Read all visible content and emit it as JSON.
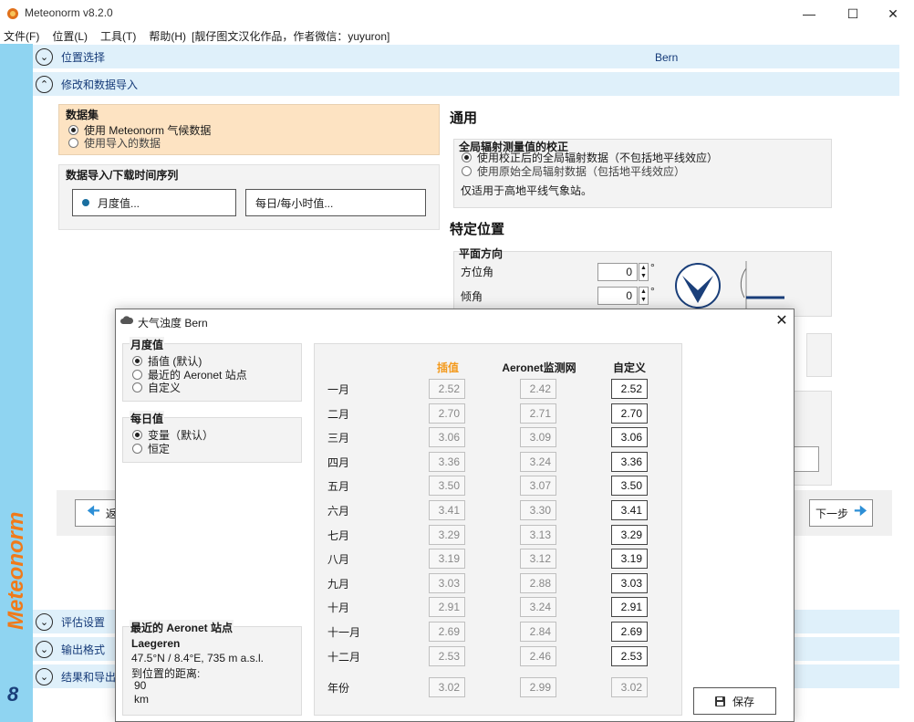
{
  "app": {
    "title": "Meteonorm v8.2.0"
  },
  "window_controls": {
    "minimize": "—",
    "maximize": "☐",
    "close": "✕"
  },
  "menu": [
    "文件(F)",
    "位置(L)",
    "工具(T)",
    "帮助(H)",
    "[靓仔图文汉化作品，作者微信：yuyuron]"
  ],
  "sidebar": {
    "brand": "Meteonorm",
    "version": "8"
  },
  "sections": {
    "location": {
      "label": "位置选择",
      "value": "Bern"
    },
    "modify": {
      "label": "修改和数据导入"
    },
    "eval": {
      "label": "评估设置"
    },
    "output": {
      "label": "输出格式"
    },
    "results": {
      "label": "结果和导出"
    }
  },
  "dataset": {
    "title": "数据集",
    "options": [
      "使用 Meteonorm 气候数据",
      "使用导入的数据"
    ],
    "selected": 0
  },
  "import": {
    "title": "数据导入/下载时间序列",
    "monthly_btn": "月度值...",
    "daily_btn": "每日/每小时值..."
  },
  "general": {
    "heading": "通用",
    "correction_title": "全局辐射测量值的校正",
    "options": [
      "使用校正后的全局辐射数据（不包括地平线效应）",
      "使用原始全局辐射数据（包括地平线效应）"
    ],
    "selected": 0,
    "note": "仅适用于高地平线气象站。"
  },
  "specific": {
    "heading": "特定位置",
    "plane_title": "平面方向",
    "azimuth_label": "方位角",
    "azimuth_value": "0",
    "tilt_label": "倾角",
    "tilt_value": "0",
    "degree": "°"
  },
  "nav": {
    "back": "返",
    "next": "下一步"
  },
  "modal": {
    "title": "大气浊度 Bern",
    "monthly_title": "月度值",
    "monthly_options": [
      "插值 (默认)",
      "最近的 Aeronet 站点",
      "自定义"
    ],
    "monthly_selected": 0,
    "daily_title": "每日值",
    "daily_options": [
      "变量（默认）",
      "恒定"
    ],
    "daily_selected": 0,
    "col_interp": "插值",
    "col_aeronet": "Aeronet监测网",
    "col_custom": "自定义",
    "months": [
      "一月",
      "二月",
      "三月",
      "四月",
      "五月",
      "六月",
      "七月",
      "八月",
      "九月",
      "十月",
      "十一月",
      "十二月"
    ],
    "interp": [
      "2.52",
      "2.70",
      "3.06",
      "3.36",
      "3.50",
      "3.41",
      "3.29",
      "3.19",
      "3.03",
      "2.91",
      "2.69",
      "2.53"
    ],
    "aeronet": [
      "2.42",
      "2.71",
      "3.09",
      "3.24",
      "3.07",
      "3.30",
      "3.13",
      "3.12",
      "2.88",
      "3.24",
      "2.84",
      "2.46"
    ],
    "custom": [
      "2.52",
      "2.70",
      "3.06",
      "3.36",
      "3.50",
      "3.41",
      "3.29",
      "3.19",
      "3.03",
      "2.91",
      "2.69",
      "2.53"
    ],
    "year_label": "年份",
    "year_interp": "3.02",
    "year_aeronet": "2.99",
    "year_custom": "3.02",
    "nearest_title": "最近的 Aeronet 站点",
    "station_name": "Laegeren",
    "station_coords": "47.5°N / 8.4°E, 735 m a.s.l.",
    "distance_label": "到位置的距离:",
    "distance_value": "90",
    "distance_unit": "km",
    "save": "保存",
    "close": "✕"
  },
  "colors": {
    "accent": "#f39a1e",
    "sidebar": "#8fd4f1",
    "section": "#dff0fa",
    "brand": "#f07a1a",
    "link": "#153a78"
  }
}
